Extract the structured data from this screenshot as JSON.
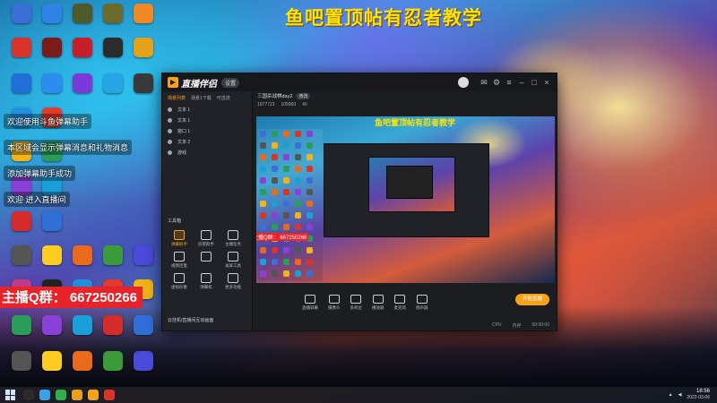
{
  "overlay": {
    "title": "鱼吧置顶帖有忍者教学",
    "qq_group": "主播Q群：  667250266"
  },
  "desktop_icons": [
    {
      "label": "",
      "color": "#3b6fd8",
      "icon": "computer-icon"
    },
    {
      "label": "",
      "color": "#2f83e6",
      "icon": "folder-icon"
    },
    {
      "label": "",
      "color": "#4e5a2a",
      "icon": "game-icon"
    },
    {
      "label": "",
      "color": "#6a6a2a",
      "icon": "game-icon"
    },
    {
      "label": "",
      "color": "#f08a24",
      "icon": "app-icon"
    },
    {
      "label": "",
      "color": "#d9342b",
      "icon": "app-icon"
    },
    {
      "label": "",
      "color": "#7a1c1c",
      "icon": "app-icon"
    },
    {
      "label": "",
      "color": "#c81e2c",
      "icon": "heart-icon"
    },
    {
      "label": "",
      "color": "#2b2b2b",
      "icon": "app-icon"
    },
    {
      "label": "",
      "color": "#e3a21a",
      "icon": "rockstar-icon"
    },
    {
      "label": "",
      "color": "#1f6fd6",
      "icon": "app-icon"
    },
    {
      "label": "",
      "color": "#2d8cf0",
      "icon": "k-icon"
    },
    {
      "label": "",
      "color": "#7b3ad8",
      "icon": "app-icon"
    },
    {
      "label": "",
      "color": "#26a5e4",
      "icon": "cloud-icon"
    },
    {
      "label": "",
      "color": "#3a3a3a",
      "icon": "app-icon"
    }
  ],
  "chat": [
    {
      "text": "欢迎使用斗鱼弹幕助手"
    },
    {
      "text": "本区域会显示弹幕消息和礼物消息"
    },
    {
      "text": "添加弹幕助手成功"
    },
    {
      "prefix": "欢迎",
      "name": "",
      "text": "进入直播间"
    }
  ],
  "app": {
    "name": "直播伴侣",
    "pill": "设置",
    "left_tabs": [
      "场景列表",
      "场景1下载",
      "可选流"
    ],
    "scenes": [
      "文本 1",
      "文本 1",
      "窗口 1",
      "文本 2",
      "游戏"
    ],
    "tools_title": "工具箱",
    "tools": [
      {
        "label": "弹幕助手",
        "hot": true
      },
      {
        "label": "房管助手",
        "hot": false
      },
      {
        "label": "主播任务",
        "hot": false
      },
      {
        "label": "视频连麦",
        "hot": false
      },
      {
        "label": "",
        "hot": false
      },
      {
        "label": "录屏工具",
        "hot": false
      },
      {
        "label": "虚拟形象",
        "hot": false
      },
      {
        "label": "弹幕机",
        "hot": false
      },
      {
        "label": "更多功能",
        "hot": false
      }
    ],
    "footer": "云挂机/直播间互动画面",
    "room_title": "三国杀战棋day2",
    "room_tag": "修改",
    "stats": [
      "1977723",
      "105960",
      "40"
    ],
    "preview_title": "鱼吧置顶帖有忍者教学",
    "preview_qq": "主播Q群：  667250266",
    "controls": [
      "直播屏幕",
      "摄像头",
      "多机位",
      "播放器",
      "麦克风",
      "扬声器"
    ],
    "live_button": "开始直播",
    "status": [
      "CPU",
      "内存",
      "00:00:00"
    ]
  },
  "taskbar": {
    "time": "18:56",
    "date": "2022-03-06"
  }
}
